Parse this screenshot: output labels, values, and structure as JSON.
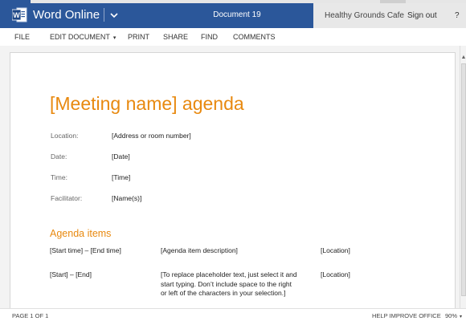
{
  "titlebar": {
    "app_name": "Word Online",
    "document_name": "Document 19",
    "account_name": "Healthy Grounds Cafe",
    "sign_out": "Sign out",
    "help": "?",
    "bar_color": "#2b579a"
  },
  "menu": {
    "file": "FILE",
    "edit_document": "EDIT DOCUMENT",
    "print": "PRINT",
    "share": "SHARE",
    "find": "FIND",
    "comments": "COMMENTS"
  },
  "document": {
    "title": "[Meeting name] agenda",
    "accent_color": "#e8890f",
    "meta": [
      {
        "label": "Location:",
        "value": "[Address or room number]"
      },
      {
        "label": "Date:",
        "value": "[Date]"
      },
      {
        "label": "Time:",
        "value": "[Time]"
      },
      {
        "label": "Facilitator:",
        "value": "[Name(s)]"
      }
    ],
    "section_heading": "Agenda items",
    "agenda_rows": [
      {
        "time": "[Start time] – [End time]",
        "description": "[Agenda item description]",
        "location": "[Location]"
      },
      {
        "time": "[Start] – [End]",
        "description": "[To replace placeholder text, just select it and start typing. Don’t include space to the right or left of the characters in your selection.]",
        "location": "[Location]"
      }
    ]
  },
  "status": {
    "page_count": "PAGE 1 OF 1",
    "help_improve": "HELP IMPROVE OFFICE",
    "zoom": "90%"
  },
  "icons": {
    "app_logo": "word-logo-icon",
    "title_dropdown": "chevron-down-icon",
    "menu_dropdown": "caret-down-icon",
    "scroll_up": "scroll-up-arrow-icon",
    "zoom_dropdown": "caret-down-icon"
  }
}
